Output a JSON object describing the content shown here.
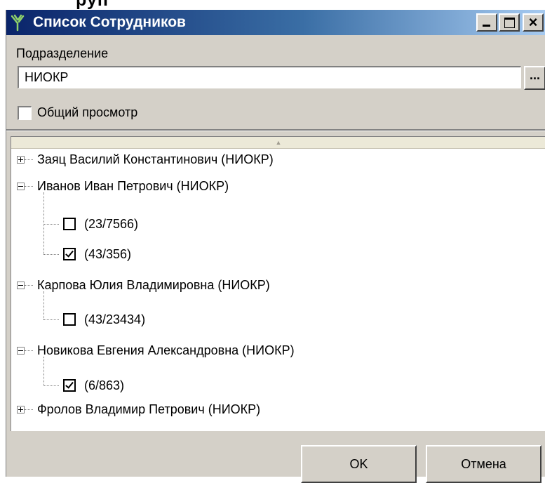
{
  "window": {
    "title": "Список Сотрудников",
    "title_buttons": {
      "minimize": "_",
      "maximize": "□",
      "close": "×"
    }
  },
  "background_title_fragment": "руп",
  "division": {
    "label": "Подразделение",
    "value": "НИОКР",
    "browse_label": "..."
  },
  "overview": {
    "label": "Общий просмотр",
    "checked": false
  },
  "tree": {
    "sort_indicator": "▲",
    "nodes": [
      {
        "label": "Заяц Василий Константинович (НИОКР)",
        "expanded": false,
        "children": []
      },
      {
        "label": "Иванов Иван Петрович (НИОКР)",
        "expanded": true,
        "children": [
          {
            "label": "(23/7566)",
            "checked": false
          },
          {
            "label": "(43/356)",
            "checked": true
          }
        ]
      },
      {
        "label": "Карпова Юлия Владимировна (НИОКР)",
        "expanded": true,
        "children": [
          {
            "label": "(43/23434)",
            "checked": false
          }
        ]
      },
      {
        "label": "Новикова Евгения Александровна (НИОКР)",
        "expanded": true,
        "children": [
          {
            "label": "(6/863)",
            "checked": true
          }
        ]
      },
      {
        "label": "Фролов Владимир Петрович (НИОКР)",
        "expanded": false,
        "children": []
      }
    ]
  },
  "buttons": {
    "ok": "OK",
    "cancel": "Отмена"
  }
}
